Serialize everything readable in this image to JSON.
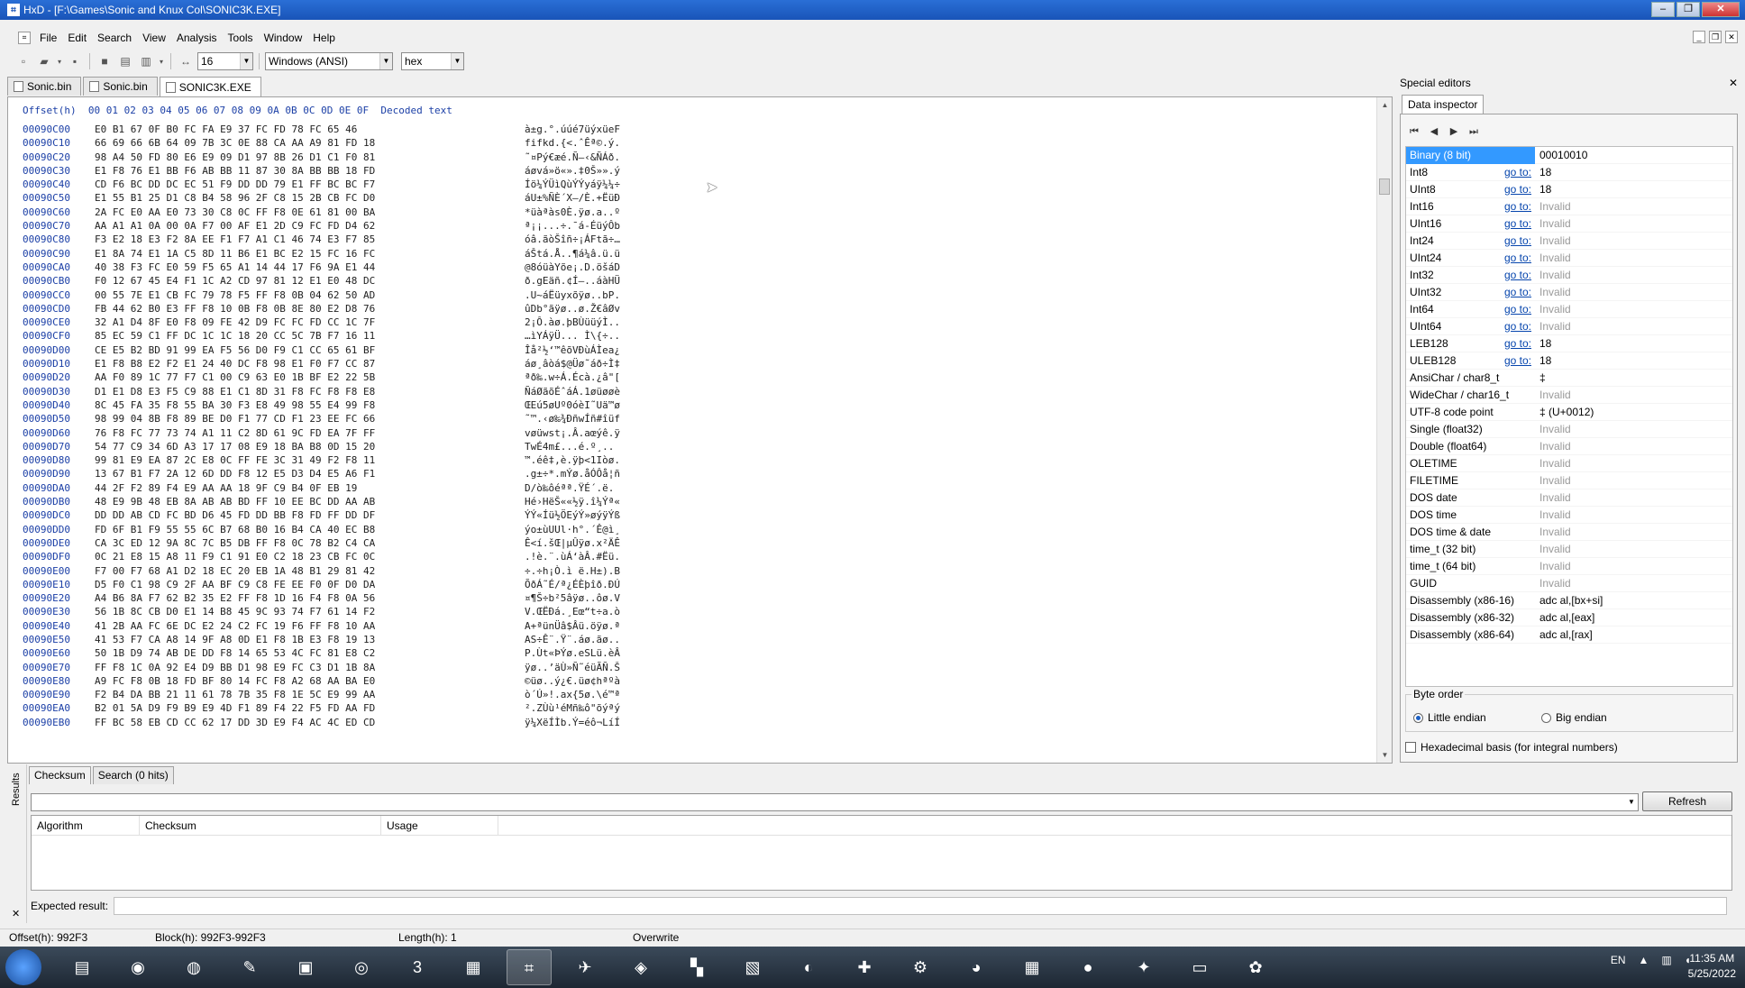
{
  "window": {
    "title": "HxD - [F:\\Games\\Sonic and Knux Col\\SONIC3K.EXE]",
    "controls": [
      "–",
      "❐",
      "✕"
    ]
  },
  "menu": [
    "File",
    "Edit",
    "Search",
    "View",
    "Analysis",
    "Tools",
    "Window",
    "Help"
  ],
  "toolbar": {
    "bytes_per_row": "16",
    "charset": "Windows (ANSI)",
    "display_mode": "hex"
  },
  "tabs": [
    "Sonic.bin",
    "Sonic.bin",
    "SONIC3K.EXE"
  ],
  "hex": {
    "header_offset": "Offset(h)",
    "header_columns": "00 01 02 03 04 05 06 07 08 09 0A 0B 0C 0D 0E 0F",
    "header_decoded": "Decoded text",
    "rows": [
      {
        "o": "00090C00",
        "b": "E0 B1 67 0F B0 FC FA E9 37 FC FD 78 FC 65 46",
        "t": "à±g.°.úúé7üýxüeF"
      },
      {
        "o": "00090C10",
        "b": "66 69 66 6B 64 09 7B 3C 0E 88 CA AA A9 81 FD 18",
        "t": "fifkd.{<.ˆÊª©.ý."
      },
      {
        "o": "00090C20",
        "b": "98 A4 50 FD 80 E6 E9 09 D1 97 8B 26 D1 C1 F0 81",
        "t": "˜¤Pý€æé.Ñ—‹&ÑÁð."
      },
      {
        "o": "00090C30",
        "b": "E1 F8 76 E1 BB F6 AB BB 11 87 30 8A BB BB 18 FD",
        "t": "áøvá»ö«».‡0Š»».ý"
      },
      {
        "o": "00090C40",
        "b": "CD F6 BC DD DC EC 51 F9 DD DD 79 E1 FF BC BC F7",
        "t": "Íö¼ÝÜìQùÝÝyáÿ¼¼÷"
      },
      {
        "o": "00090C50",
        "b": "E1 55 B1 25 D1 C8 B4 58 96 2F C8 15 2B CB FC D0",
        "t": "áU±%ÑÈ´X–/È.+ËüÐ"
      },
      {
        "o": "00090C60",
        "b": "2A FC E0 AA E0 73 30 C8 0C FF F8 0E 61 81 00 BA",
        "t": "*üàªàs0È.ÿø.a..º"
      },
      {
        "o": "00090C70",
        "b": "AA A1 A1 0A 00 0A F7 00 AF E1 2D C9 FC FD D4 62",
        "t": "ª¡¡...÷.¯á-ÉüýÔb"
      },
      {
        "o": "00090C80",
        "b": "F3 E2 18 E3 F2 8A EE F1 F7 A1 C1 46 74 E3 F7 85",
        "t": "óâ.ãòŠîñ÷¡ÁFtã÷…"
      },
      {
        "o": "00090C90",
        "b": "E1 8A 74 E1 1A C5 8D 11 B6 E1 BC E2 15 FC 16 FC",
        "t": "áŠtá.Å..¶á¼â.ü.ü"
      },
      {
        "o": "00090CA0",
        "b": "40 38 F3 FC E0 59 F5 65 A1 14 44 17 F6 9A E1 44",
        "t": "@8óüàYõe¡.D.öšáD"
      },
      {
        "o": "00090CB0",
        "b": "F0 12 67 45 E4 F1 1C A2 CD 97 81 12 E1 E0 48 DC",
        "t": "ð.gEäñ.¢Í—..áàHÜ"
      },
      {
        "o": "00090CC0",
        "b": "00 55 7E E1 CB FC 79 78 F5 FF F8 0B 04 62 50 AD",
        "t": ".U~áËüyxõÿø..bP."
      },
      {
        "o": "00090CD0",
        "b": "FB 44 62 B0 E3 FF F8 10 0B F8 0B 8E 80 E2 D8 76",
        "t": "ûDb°ãÿø..ø.Ž€âØv"
      },
      {
        "o": "00090CE0",
        "b": "32 A1 D4 8F E0 F8 09 FE 42 D9 FC FC FD CC 1C 7F",
        "t": "2¡Ô.àø.þBÙüüýÌ.."
      },
      {
        "o": "00090CF0",
        "b": "85 EC 59 C1 FF DC 1C 1C 18 20 CC 5C 7B F7 16 11",
        "t": "…ìYÁÿÜ... Ì\\{÷.."
      },
      {
        "o": "00090D00",
        "b": "CE E5 B2 BD 91 99 EA F5 56 D0 F9 C1 CC 65 61 BF",
        "t": "Îå²½‘™êõVÐùÁÌea¿"
      },
      {
        "o": "00090D10",
        "b": "E1 F8 B8 E2 F2 E1 24 40 DC F8 98 E1 F0 F7 CC 87",
        "t": "áø¸âòá$@Üø˜áð÷Ì‡"
      },
      {
        "o": "00090D20",
        "b": "AA F0 89 1C 77 F7 C1 00 C9 63 E0 1B BF E2 22 5B",
        "t": "ªð‰.w÷Á.Écà.¿â\"["
      },
      {
        "o": "00090D30",
        "b": "D1 E1 D8 E3 F5 C9 88 E1 C1 8D 31 F8 FC F8 F8 E8",
        "t": "ÑáØãõÉˆáÁ.1øüøøè"
      },
      {
        "o": "00090D40",
        "b": "8C 45 FA 35 F8 55 BA 30 F3 E8 49 98 55 E4 99 F8",
        "t": "ŒEú5øUº0óèI˜Uä™ø"
      },
      {
        "o": "00090D50",
        "b": "98 99 04 8B F8 89 BE D0 F1 77 CD F1 23 EE FC 66",
        "t": "˜™.‹ø‰¾ÐñwÍñ#îüf"
      },
      {
        "o": "00090D60",
        "b": "76 F8 FC 77 73 74 A1 11 C2 8D 61 9C FD EA 7F FF",
        "t": "vøüwst¡.Â.aœýê.ÿ"
      },
      {
        "o": "00090D70",
        "b": "54 77 C9 34 6D A3 17 17 08 E9 18 BA B8 0D 15 20",
        "t": "TwÉ4m£...é.º¸.. "
      },
      {
        "o": "00090D80",
        "b": "99 81 E9 EA 87 2C E8 0C FF FE 3C 31 49 F2 F8 11",
        "t": "™.éê‡,è.ÿþ<1Iòø."
      },
      {
        "o": "00090D90",
        "b": "13 67 B1 F7 2A 12 6D DD F8 12 E5 D3 D4 E5 A6 F1",
        "t": ".g±÷*.mÝø.åÓÔå¦ñ"
      },
      {
        "o": "00090DA0",
        "b": "44 2F F2 89 F4 E9 AA AA 18 9F C9 B4 0F EB 19",
        "t": "D/ò‰ôéªª.ŸÉ´.ë."
      },
      {
        "o": "00090DB0",
        "b": "48 E9 9B 48 EB 8A AB AB BD FF 10 EE BC DD AA AB",
        "t": "Hé›HëŠ««½ÿ.î¼Ýª«"
      },
      {
        "o": "00090DC0",
        "b": "DD DD AB CD FC BD D6 45 FD DD BB F8 FD FF DD DF",
        "t": "ÝÝ«Íü½ÖEýÝ»øýÿÝß"
      },
      {
        "o": "00090DD0",
        "b": "FD 6F B1 F9 55 55 6C B7 68 B0 16 B4 CA 40 EC B8",
        "t": "ýo±ùUUl·h°.´Ê@ì¸"
      },
      {
        "o": "00090DE0",
        "b": "CA 3C ED 12 9A 8C 7C B5 DB FF F8 0C 78 B2 C4 CA",
        "t": "Ê<í.šŒ|µÛÿø.x²ÄÊ"
      },
      {
        "o": "00090DF0",
        "b": "0C 21 E8 15 A8 11 F9 C1 91 E0 C2 18 23 CB FC 0C",
        "t": ".!è.¨.ùÁ‘àÂ.#Ëü."
      },
      {
        "o": "00090E00",
        "b": "F7 00 F7 68 A1 D2 18 EC 20 EB 1A 48 B1 29 81 42",
        "t": "÷.÷h¡Ò.ì ë.H±).B"
      },
      {
        "o": "00090E10",
        "b": "D5 F0 C1 98 C9 2F AA BF C9 C8 FE EE F0 0F D0 DA",
        "t": "ÕðÁ˜É/ª¿ÉÈþîð.ÐÚ"
      },
      {
        "o": "00090E20",
        "b": "A4 B6 8A F7 62 B2 35 E2 FF F8 1D 16 F4 F8 0A 56",
        "t": "¤¶Š÷b²5âÿø..ôø.V"
      },
      {
        "o": "00090E30",
        "b": "56 1B 8C CB D0 E1 14 B8 45 9C 93 74 F7 61 14 F2",
        "t": "V.ŒËÐá.¸Eœ“t÷a.ò"
      },
      {
        "o": "00090E40",
        "b": "41 2B AA FC 6E DC E2 24 C2 FC 19 F6 FF F8 10 AA",
        "t": "A+ªünÜâ$Âü.öÿø.ª"
      },
      {
        "o": "00090E50",
        "b": "41 53 F7 CA A8 14 9F A8 0D E1 F8 1B E3 F8 19 13",
        "t": "AS÷Ê¨.Ÿ¨.áø.ãø.."
      },
      {
        "o": "00090E60",
        "b": "50 1B D9 74 AB DE DD F8 14 65 53 4C FC 81 E8 C2",
        "t": "P.Ùt«ÞÝø.eSLü.èÂ"
      },
      {
        "o": "00090E70",
        "b": "FF F8 1C 0A 92 E4 D9 BB D1 98 E9 FC C3 D1 1B 8A",
        "t": "ÿø..’äÙ»Ñ˜éüÃÑ.Š"
      },
      {
        "o": "00090E80",
        "b": "A9 FC F8 0B 18 FD BF 80 14 FC F8 A2 68 AA BA E0",
        "t": "©üø..ý¿€.üø¢hªºà"
      },
      {
        "o": "00090E90",
        "b": "F2 B4 DA BB 21 11 61 78 7B 35 F8 1E 5C E9 99 AA",
        "t": "ò´Ú»!.ax{5ø.\\é™ª"
      },
      {
        "o": "00090EA0",
        "b": "B2 01 5A D9 F9 B9 E9 4D F1 89 F4 22 F5 FD AA FD",
        "t": "².ZÙù¹éMñ‰ô\"õýªý"
      },
      {
        "o": "00090EB0",
        "b": "FF BC 58 EB CD CC 62 17 DD 3D E9 F4 AC 4C ED CD",
        "t": "ÿ¼XëÍÌb.Ý=éô¬LíÍ"
      }
    ]
  },
  "special_editors": {
    "title": "Special editors",
    "tab": "Data inspector",
    "goto_label": "go to:",
    "rows": [
      {
        "name": "Binary (8 bit)",
        "goto": false,
        "value": "00010010",
        "invalid": false
      },
      {
        "name": "Int8",
        "goto": true,
        "value": "18",
        "invalid": false
      },
      {
        "name": "UInt8",
        "goto": true,
        "value": "18",
        "invalid": false
      },
      {
        "name": "Int16",
        "goto": true,
        "value": "Invalid",
        "invalid": true
      },
      {
        "name": "UInt16",
        "goto": true,
        "value": "Invalid",
        "invalid": true
      },
      {
        "name": "Int24",
        "goto": true,
        "value": "Invalid",
        "invalid": true
      },
      {
        "name": "UInt24",
        "goto": true,
        "value": "Invalid",
        "invalid": true
      },
      {
        "name": "Int32",
        "goto": true,
        "value": "Invalid",
        "invalid": true
      },
      {
        "name": "UInt32",
        "goto": true,
        "value": "Invalid",
        "invalid": true
      },
      {
        "name": "Int64",
        "goto": true,
        "value": "Invalid",
        "invalid": true
      },
      {
        "name": "UInt64",
        "goto": true,
        "value": "Invalid",
        "invalid": true
      },
      {
        "name": "LEB128",
        "goto": true,
        "value": "18",
        "invalid": false
      },
      {
        "name": "ULEB128",
        "goto": true,
        "value": "18",
        "invalid": false
      },
      {
        "name": "AnsiChar / char8_t",
        "goto": false,
        "value": "‡",
        "invalid": false
      },
      {
        "name": "WideChar / char16_t",
        "goto": false,
        "value": "Invalid",
        "invalid": true
      },
      {
        "name": "UTF-8 code point",
        "goto": false,
        "value": "‡ (U+0012)",
        "invalid": false
      },
      {
        "name": "Single (float32)",
        "goto": false,
        "value": "Invalid",
        "invalid": true
      },
      {
        "name": "Double (float64)",
        "goto": false,
        "value": "Invalid",
        "invalid": true
      },
      {
        "name": "OLETIME",
        "goto": false,
        "value": "Invalid",
        "invalid": true
      },
      {
        "name": "FILETIME",
        "goto": false,
        "value": "Invalid",
        "invalid": true
      },
      {
        "name": "DOS date",
        "goto": false,
        "value": "Invalid",
        "invalid": true
      },
      {
        "name": "DOS time",
        "goto": false,
        "value": "Invalid",
        "invalid": true
      },
      {
        "name": "DOS time & date",
        "goto": false,
        "value": "Invalid",
        "invalid": true
      },
      {
        "name": "time_t (32 bit)",
        "goto": false,
        "value": "Invalid",
        "invalid": true
      },
      {
        "name": "time_t (64 bit)",
        "goto": false,
        "value": "Invalid",
        "invalid": true
      },
      {
        "name": "GUID",
        "goto": false,
        "value": "Invalid",
        "invalid": true
      },
      {
        "name": "Disassembly (x86-16)",
        "goto": false,
        "value": "adc al,[bx+si]",
        "invalid": false
      },
      {
        "name": "Disassembly (x86-32)",
        "goto": false,
        "value": "adc al,[eax]",
        "invalid": false
      },
      {
        "name": "Disassembly (x86-64)",
        "goto": false,
        "value": "adc al,[rax]",
        "invalid": false
      }
    ],
    "byte_order_label": "Byte order",
    "little_endian": "Little endian",
    "big_endian": "Big endian",
    "hex_basis": "Hexadecimal basis (for integral numbers)"
  },
  "results": {
    "side_label": "Results",
    "tabs": [
      "Checksum",
      "Search (0 hits)"
    ],
    "refresh": "Refresh",
    "columns": [
      "Algorithm",
      "Checksum",
      "Usage"
    ],
    "expected_label": "Expected result:"
  },
  "status": {
    "offset": "Offset(h): 992F3",
    "block": "Block(h): 992F3-992F3",
    "length": "Length(h): 1",
    "mode": "Overwrite"
  },
  "taskbar": {
    "lang": "EN",
    "time": "11:35 AM",
    "date": "5/25/2022"
  },
  "colors": {
    "title_bar": "#1954b8",
    "offset_blue": "#1b3fa6",
    "selection": "#3399ff",
    "link": "#0645ad"
  }
}
